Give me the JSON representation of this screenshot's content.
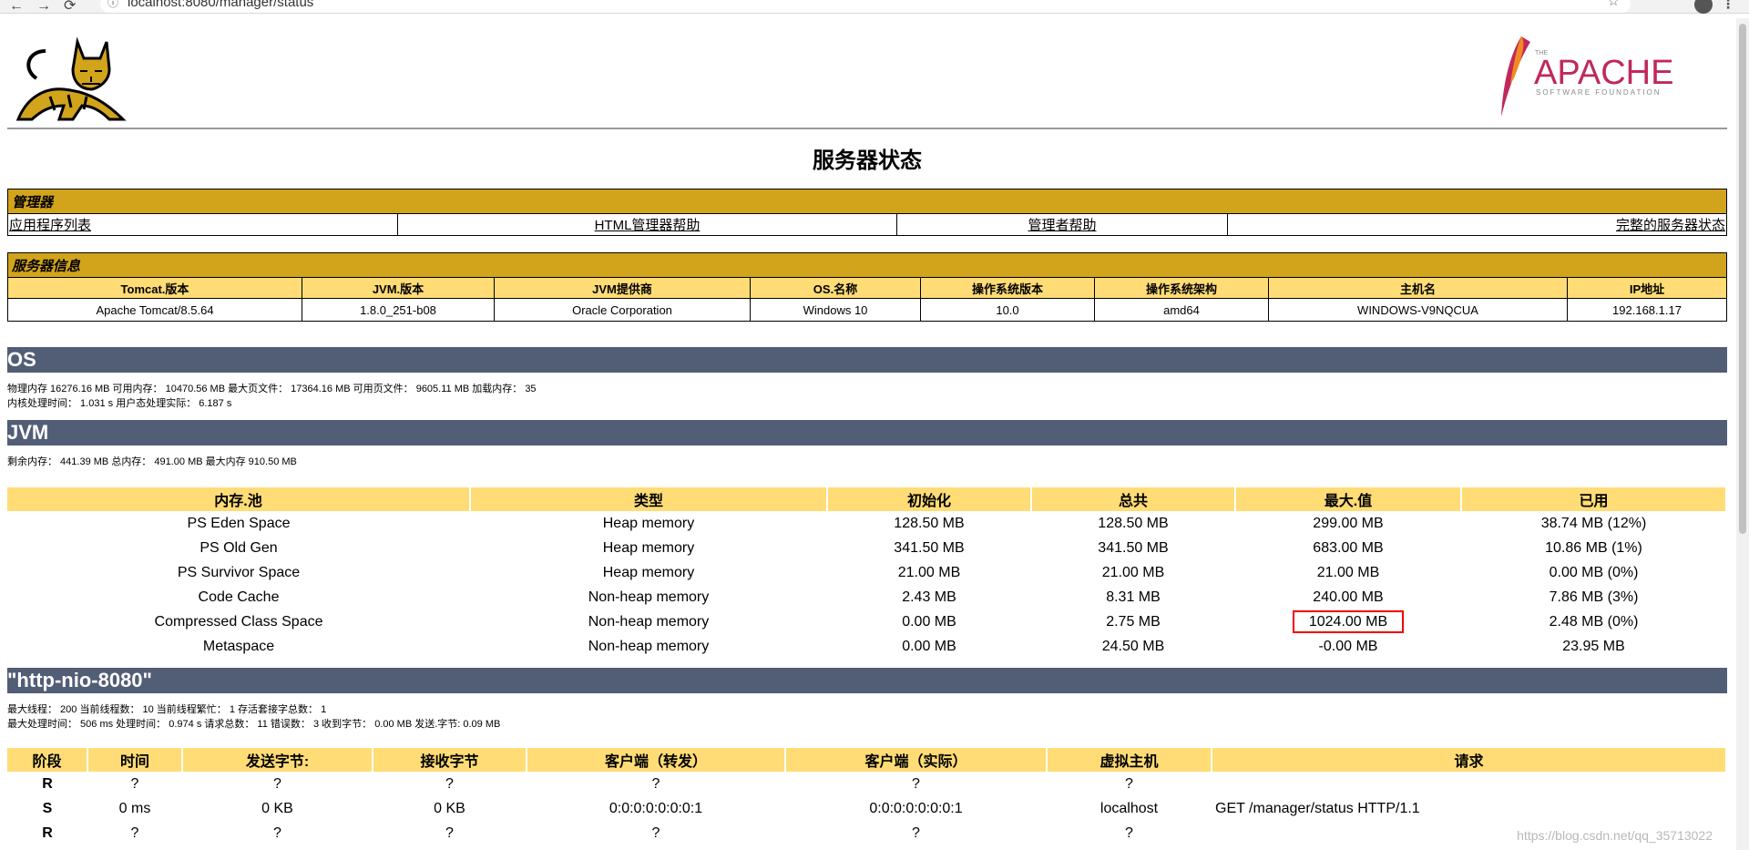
{
  "browser": {
    "url": "localhost:8080/manager/status"
  },
  "page_title": "服务器状态",
  "apache_logo": {
    "small": "THE",
    "main": "APACHE",
    "sub": "SOFTWARE FOUNDATION"
  },
  "manager": {
    "title": "管理器",
    "links": [
      "应用程序列表",
      "HTML管理器帮助",
      "管理者帮助",
      "完整的服务器状态"
    ]
  },
  "server_info": {
    "title": "服务器信息",
    "headers": [
      "Tomcat.版本",
      "JVM.版本",
      "JVM提供商",
      "OS.名称",
      "操作系统版本",
      "操作系统架构",
      "主机名",
      "IP地址"
    ],
    "values": [
      "Apache Tomcat/8.5.64",
      "1.8.0_251-b08",
      "Oracle Corporation",
      "Windows 10",
      "10.0",
      "amd64",
      "WINDOWS-V9NQCUA",
      "192.168.1.17"
    ]
  },
  "os": {
    "title": "OS",
    "line1": "物理内存 16276.16 MB 可用内存： 10470.56 MB 最大页文件： 17364.16 MB 可用页文件： 9605.11 MB 加载内存： 35",
    "line2": "内核处理时间： 1.031 s 用户态处理实际： 6.187 s"
  },
  "jvm": {
    "title": "JVM",
    "line1": "剩余内存： 441.39 MB 总内存： 491.00 MB 最大内存 910.50 MB",
    "headers": [
      "内存.池",
      "类型",
      "初始化",
      "总共",
      "最大.值",
      "已用"
    ],
    "rows": [
      [
        "PS Eden Space",
        "Heap memory",
        "128.50 MB",
        "128.50 MB",
        "299.00 MB",
        "38.74 MB (12%)"
      ],
      [
        "PS Old Gen",
        "Heap memory",
        "341.50 MB",
        "341.50 MB",
        "683.00 MB",
        "10.86 MB (1%)"
      ],
      [
        "PS Survivor Space",
        "Heap memory",
        "21.00 MB",
        "21.00 MB",
        "21.00 MB",
        "0.00 MB (0%)"
      ],
      [
        "Code Cache",
        "Non-heap memory",
        "2.43 MB",
        "8.31 MB",
        "240.00 MB",
        "7.86 MB (3%)"
      ],
      [
        "Compressed Class Space",
        "Non-heap memory",
        "0.00 MB",
        "2.75 MB",
        "1024.00 MB",
        "2.48 MB (0%)"
      ],
      [
        "Metaspace",
        "Non-heap memory",
        "0.00 MB",
        "24.50 MB",
        "-0.00 MB",
        "23.95 MB"
      ]
    ]
  },
  "connector": {
    "title": "\"http-nio-8080\"",
    "line1": "最大线程： 200 当前线程数： 10 当前线程繁忙： 1 存活套接字总数： 1",
    "line2": "最大处理时间： 506 ms 处理时间： 0.974 s 请求总数： 11 错误数： 3 收到字节： 0.00 MB 发送.字节: 0.09 MB",
    "headers": [
      "阶段",
      "时间",
      "发送字节:",
      "接收字节",
      "客户端（转发）",
      "客户端（实际）",
      "虚拟主机",
      "请求"
    ],
    "rows": [
      [
        "R",
        "?",
        "?",
        "?",
        "?",
        "?",
        "?",
        ""
      ],
      [
        "S",
        "0 ms",
        "0 KB",
        "0 KB",
        "0:0:0:0:0:0:0:1",
        "0:0:0:0:0:0:0:1",
        "localhost",
        "GET /manager/status HTTP/1.1"
      ],
      [
        "R",
        "?",
        "?",
        "?",
        "?",
        "?",
        "?",
        ""
      ]
    ]
  },
  "watermark": "https://blog.csdn.net/qq_35713022"
}
